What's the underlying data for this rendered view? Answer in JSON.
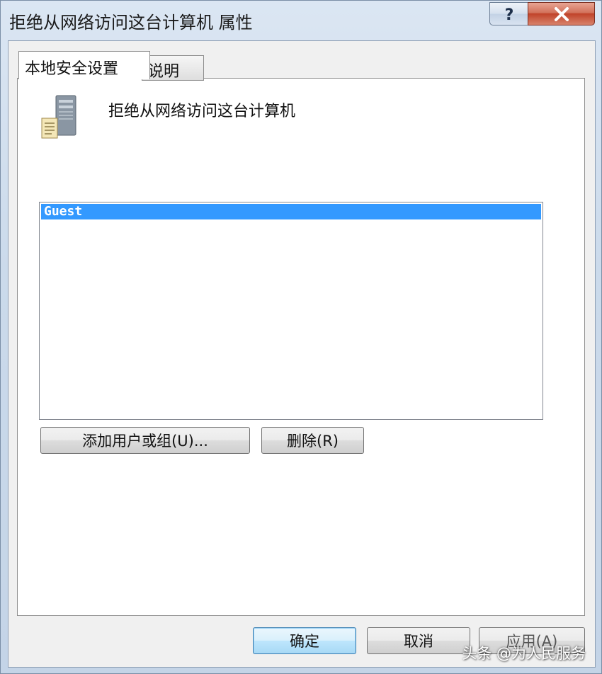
{
  "window": {
    "title": "拒绝从网络访问这台计算机 属性",
    "help_label": "?",
    "close_label": "X"
  },
  "tabs": [
    {
      "label": "本地安全设置",
      "active": true
    },
    {
      "label": "说明",
      "active": false
    }
  ],
  "policy": {
    "name": "拒绝从网络访问这台计算机",
    "icon": "server-policy-icon"
  },
  "members": [
    "Guest"
  ],
  "buttons": {
    "add": "添加用户或组(U)...",
    "remove": "删除(R)",
    "ok": "确定",
    "cancel": "取消",
    "apply": "应用(A)"
  },
  "watermark": "头条 @为人民服务",
  "colors": {
    "selection": "#3399ff",
    "close_button": "#c0432a",
    "default_button_border": "#3c7fb1"
  }
}
